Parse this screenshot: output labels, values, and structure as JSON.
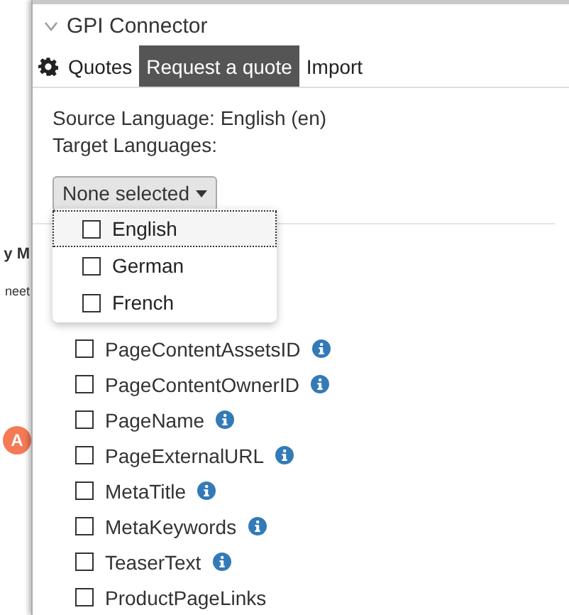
{
  "background_page": {
    "heading": "y M",
    "text": "neet",
    "logo_letter": "A"
  },
  "panel": {
    "title": "GPI Connector",
    "expanded": true
  },
  "tabs": [
    {
      "kind": "icon"
    },
    {
      "kind": "text",
      "label": "Quotes",
      "selected": false
    },
    {
      "kind": "text",
      "label": "Request a quote",
      "selected": true
    },
    {
      "kind": "text",
      "label": "Import",
      "selected": false
    }
  ],
  "source_language": "Source Language: English (en)",
  "target_languages_label": "Target Languages:",
  "language_dropdown": {
    "button": "None selected",
    "expanded": true,
    "options": [
      {
        "label": "English",
        "checked": false,
        "focused": true
      },
      {
        "label": "German",
        "checked": false,
        "focused": false
      },
      {
        "label": "French",
        "checked": false,
        "focused": false
      }
    ]
  },
  "fields": [
    {
      "label": "PageContentAssetsID",
      "checked": false,
      "info": true
    },
    {
      "label": "PageContentOwnerID",
      "checked": false,
      "info": true
    },
    {
      "label": "PageName",
      "checked": false,
      "info": true
    },
    {
      "label": "PageExternalURL",
      "checked": false,
      "info": true
    },
    {
      "label": "MetaTitle",
      "checked": false,
      "info": true
    },
    {
      "label": "MetaKeywords",
      "checked": false,
      "info": true
    },
    {
      "label": "TeaserText",
      "checked": false,
      "info": true
    },
    {
      "label": "ProductPageLinks",
      "checked": false,
      "info": false
    }
  ]
}
